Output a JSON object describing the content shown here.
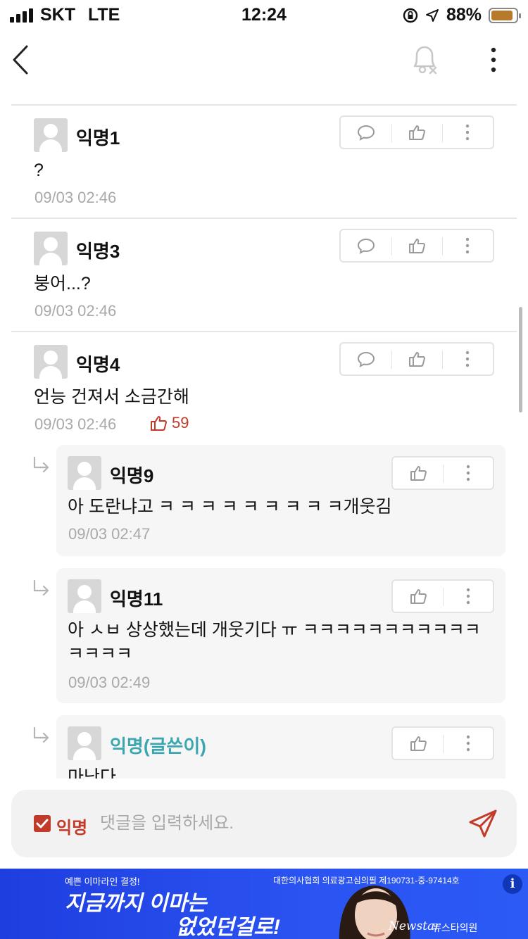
{
  "status_bar": {
    "carrier": "SKT",
    "network": "LTE",
    "time": "12:24",
    "battery_percent": "88%",
    "battery_level": 0.88
  },
  "nav": {
    "back_icon": "chevron-left-icon",
    "bell_icon": "bell-off-icon",
    "more_icon": "more-vertical-icon"
  },
  "comments": [
    {
      "author": "익명1",
      "text": "?",
      "date": "09/03 02:46"
    },
    {
      "author": "익명3",
      "text": "붕어...?",
      "date": "09/03 02:46"
    },
    {
      "author": "익명4",
      "text": "언능 건져서 소금간해",
      "date": "09/03 02:46",
      "likes": "59"
    }
  ],
  "replies": [
    {
      "author": "익명9",
      "text": "아 도란냐고 ㅋ ㅋ ㅋ ㅋ ㅋ ㅋ ㅋ ㅋ ㅋ개웃김",
      "date": "09/03 02:47"
    },
    {
      "author": "익명11",
      "text_line1": "아 ㅅㅂ 상상했는데 개웃기다 ㅠ ㅋㅋㅋㅋㅋㅋㅋㅋㅋㅋㅋ",
      "text_line2": "ㅋㅋㅋㅋ",
      "date": "09/03 02:49"
    },
    {
      "author": "익명(글쓴이)",
      "text": "마난다",
      "is_op": true
    }
  ],
  "input_bar": {
    "anon_label": "익명",
    "anon_checked": true,
    "placeholder": "댓글을 입력하세요."
  },
  "ad": {
    "tagline": "예쁜 이마라인 결정!",
    "headline1": "지금까지 이마는",
    "headline2": "없었던걸로!",
    "legal": "대한의사협회 의료광고심의필 제190731-중-97414호",
    "brand_script": "Newstar",
    "brand": "뉴스타의원",
    "info": "i"
  },
  "colors": {
    "like_red": "#c23a2a",
    "op_teal": "#3aa7b0",
    "ad_blue": "#2b54f2"
  }
}
